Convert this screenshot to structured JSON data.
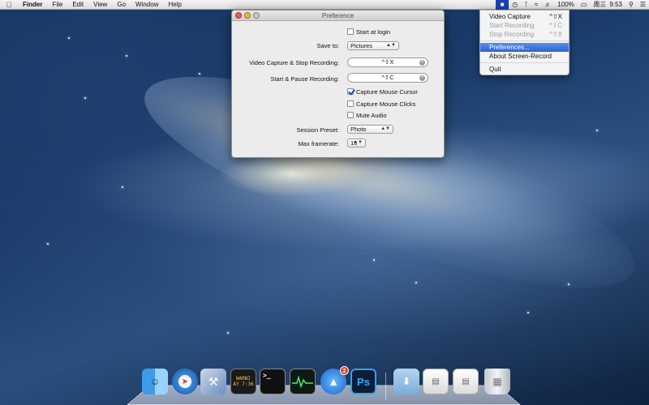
{
  "menubar": {
    "apple": "",
    "app_name": "Finder",
    "menus": [
      "File",
      "Edit",
      "View",
      "Go",
      "Window",
      "Help"
    ],
    "status": {
      "battery": "100%",
      "day": "周三",
      "time": "9:53"
    }
  },
  "window": {
    "title": "Preference",
    "start_at_login": "Start at login",
    "save_to_label": "Save to:",
    "save_to_value": "Pictures",
    "video_capture_label": "Video Capture & Stop Recording:",
    "video_capture_shortcut": "^⇧X",
    "start_pause_label": "Start & Pause Recording:",
    "start_pause_shortcut": "^⇧C",
    "capture_mouse_cursor": "Capture Mouse Cursor",
    "capture_mouse_clicks": "Capture Mouse Clicks",
    "mute_audio": "Mute Audio",
    "session_preset_label": "Session Preset:",
    "session_preset_value": "Photo",
    "max_framerate_label": "Max framerate:",
    "max_framerate_value": "15",
    "checkboxes": {
      "start_at_login": false,
      "capture_mouse_cursor": true,
      "capture_mouse_clicks": false,
      "mute_audio": false
    }
  },
  "dropdown": {
    "items": [
      {
        "label": "Video Capture",
        "shortcut": "^⇧X",
        "state": "enabled"
      },
      {
        "label": "Start Recording",
        "shortcut": "^⇧C",
        "state": "disabled"
      },
      {
        "label": "Stop Recording",
        "shortcut": "^⇧X",
        "state": "disabled"
      },
      {
        "label": "Preferences...",
        "shortcut": "",
        "state": "selected"
      },
      {
        "label": "About Screen-Record",
        "shortcut": "",
        "state": "enabled"
      },
      {
        "label": "Quit",
        "shortcut": "",
        "state": "enabled"
      }
    ]
  },
  "dock": {
    "terminal_text": ">_",
    "photoshop_text": "Ps",
    "console_text": "WARNI",
    "console_text_2": "AY 7:36",
    "appstore_badge": "2"
  },
  "colors": {
    "menu_highlight": "#2f62d5",
    "checkbox_check": "#1d4fa8",
    "close_button": "#ec5d55",
    "minimize_button": "#e9b93c"
  }
}
